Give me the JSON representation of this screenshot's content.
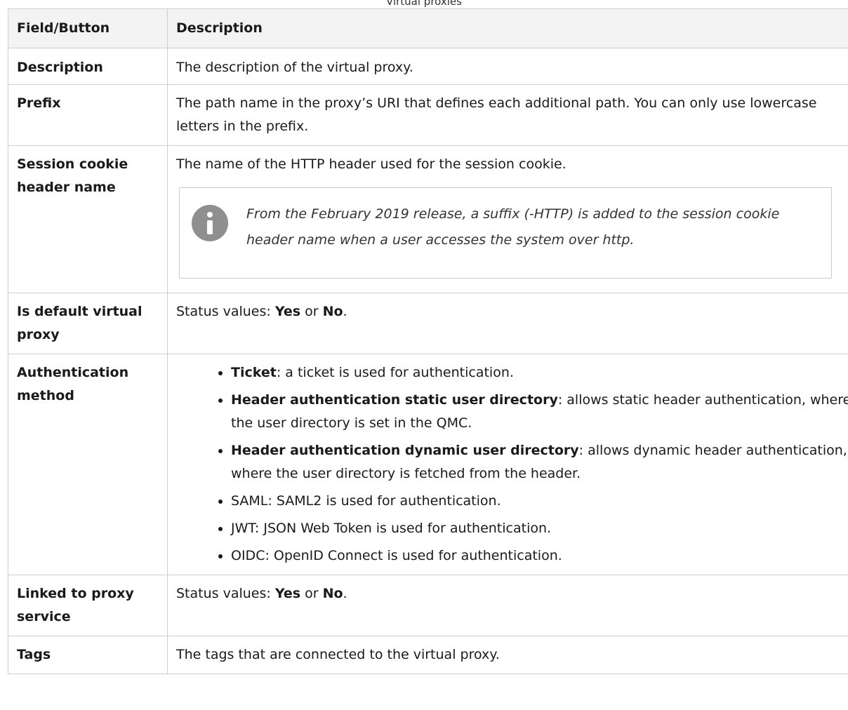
{
  "caption": "Virtual proxies",
  "headers": {
    "field": "Field/Button",
    "description": "Description"
  },
  "rows": {
    "description": {
      "field": "Description",
      "text": "The description of the virtual proxy."
    },
    "prefix": {
      "field": "Prefix",
      "text": "The path name in the proxy’s URI that defines each additional path. You can only use lowercase letters in the prefix."
    },
    "session_cookie": {
      "field": "Session cookie header name",
      "text": "The name of the HTTP header used for the session cookie.",
      "note": "From the February 2019 release, a suffix (-HTTP) is added to the session cookie header name when a user accesses the system over http.",
      "note_icon": "info-icon"
    },
    "is_default": {
      "field": "Is default virtual proxy",
      "prefix": "Status values: ",
      "yes": "Yes",
      "or": " or ",
      "no": "No",
      "suffix": "."
    },
    "auth_method": {
      "field": "Authentication method",
      "items": [
        {
          "term": "Ticket",
          "text": ": a ticket is used for authentication."
        },
        {
          "term": "Header authentication static user directory",
          "text": ": allows static header authentication, where the user directory is set in the QMC."
        },
        {
          "term": "Header authentication dynamic user directory",
          "text": ": allows dynamic header authentication, where the user directory is fetched from the header."
        },
        {
          "term": "",
          "text": "SAML: SAML2 is used for authentication."
        },
        {
          "term": "",
          "text": "JWT: JSON Web Token is used for authentication."
        },
        {
          "term": "",
          "text": "OIDC: OpenID Connect is used for authentication."
        }
      ]
    },
    "linked": {
      "field": "Linked to proxy service",
      "prefix": "Status values: ",
      "yes": "Yes",
      "or": " or ",
      "no": "No",
      "suffix": "."
    },
    "tags": {
      "field": "Tags",
      "text": "The tags that are connected to the virtual proxy."
    }
  }
}
